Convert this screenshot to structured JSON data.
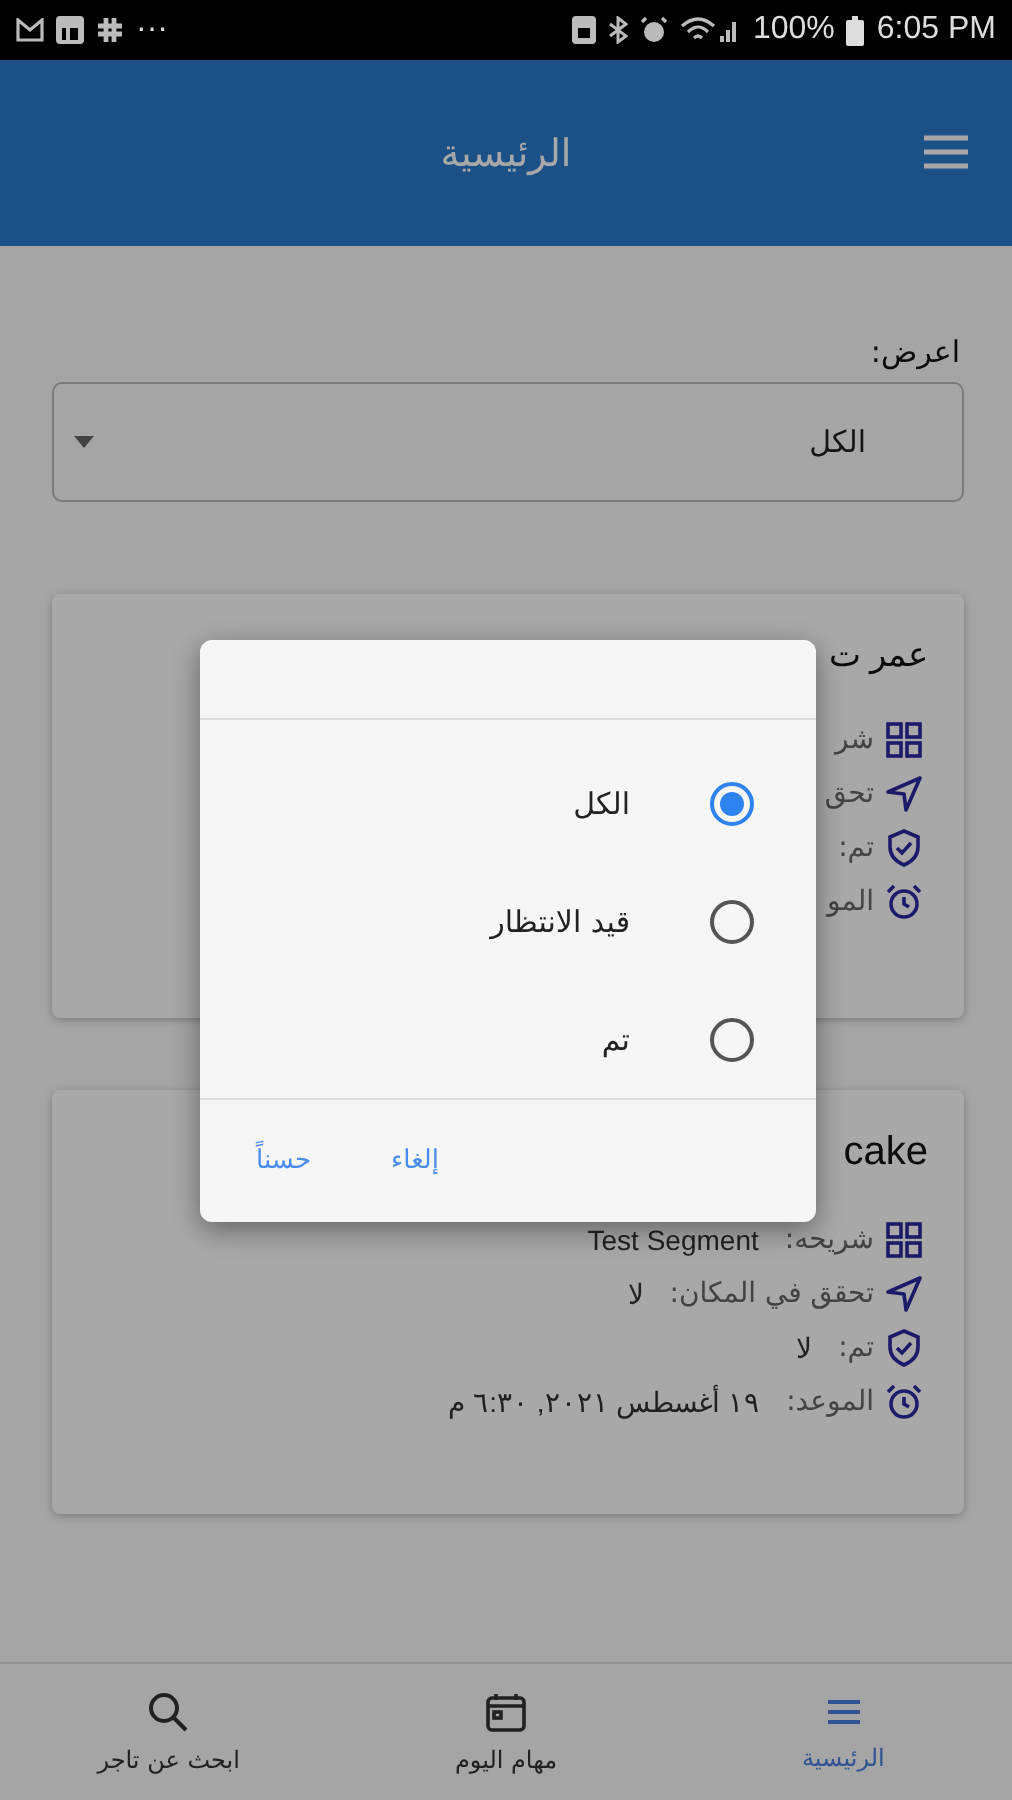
{
  "status_bar": {
    "more": "···",
    "battery": "100%",
    "time": "6:05 PM"
  },
  "app_bar": {
    "title": "الرئيسية"
  },
  "filter": {
    "label": "اعرض:",
    "value": "الكل"
  },
  "cards": [
    {
      "title": "عمر ت",
      "rows": [
        {
          "kind": "grid",
          "label": "شر"
        },
        {
          "kind": "navigation",
          "label": "تحق"
        },
        {
          "kind": "shield",
          "label": "تم:"
        },
        {
          "kind": "alarm",
          "label": "المو"
        }
      ]
    },
    {
      "title": "cake",
      "rows": [
        {
          "kind": "grid",
          "label": "شريحه:",
          "value": "Test Segment"
        },
        {
          "kind": "navigation",
          "label": "تحقق في المكان:",
          "value": "لا"
        },
        {
          "kind": "shield",
          "label": "تم:",
          "value": "لا"
        },
        {
          "kind": "alarm",
          "label": "الموعد:",
          "value": "١٩ أغسطس ٢٠٢١, ٦:٣٠ م"
        }
      ]
    }
  ],
  "dialog": {
    "options": [
      {
        "label": "الكل",
        "selected": true
      },
      {
        "label": "قيد الانتظار",
        "selected": false
      },
      {
        "label": "تم",
        "selected": false
      }
    ],
    "buttons": [
      "إلغاء",
      "حسناً"
    ]
  },
  "bottom_nav": [
    {
      "kind": "menu",
      "label": "الرئيسية",
      "selected": true
    },
    {
      "kind": "calendar",
      "label": "مهام اليوم",
      "selected": false
    },
    {
      "kind": "search",
      "label": "ابحث عن تاجر",
      "selected": false
    }
  ]
}
